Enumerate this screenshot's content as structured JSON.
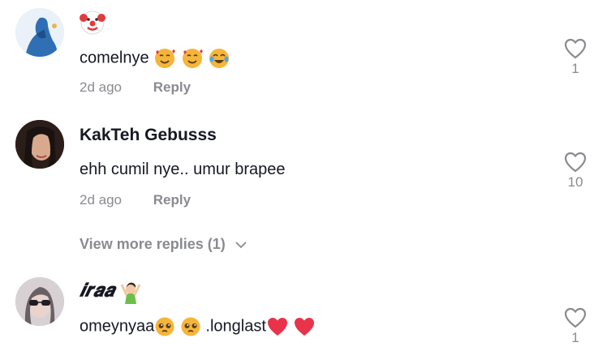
{
  "comments": [
    {
      "username": "",
      "username_emoji": "clown-face",
      "text": "comelnye",
      "text_emojis": [
        "smiling-face-with-hearts",
        "smiling-face-with-hearts",
        "tears-of-joy"
      ],
      "age": "2d ago",
      "reply_label": "Reply",
      "likes": "1"
    },
    {
      "username": "KakTeh Gebusss",
      "text": "ehh cumil nye.. umur brapee",
      "age": "2d ago",
      "reply_label": "Reply",
      "likes": "10",
      "view_more": "View more replies (1)"
    },
    {
      "username": "𝒊𝒓𝒂𝒂",
      "username_emoji": "woman-raising-hands",
      "text_part1": "omeynyaa",
      "text_part2": " .longlast",
      "text_emojis_1": [
        "pleading-face",
        "pleading-face"
      ],
      "text_emojis_2": [
        "red-heart",
        "red-heart"
      ],
      "likes": "1"
    }
  ],
  "colors": {
    "text": "#161823",
    "muted": "#8a8b91",
    "heart": "#e8334a"
  }
}
